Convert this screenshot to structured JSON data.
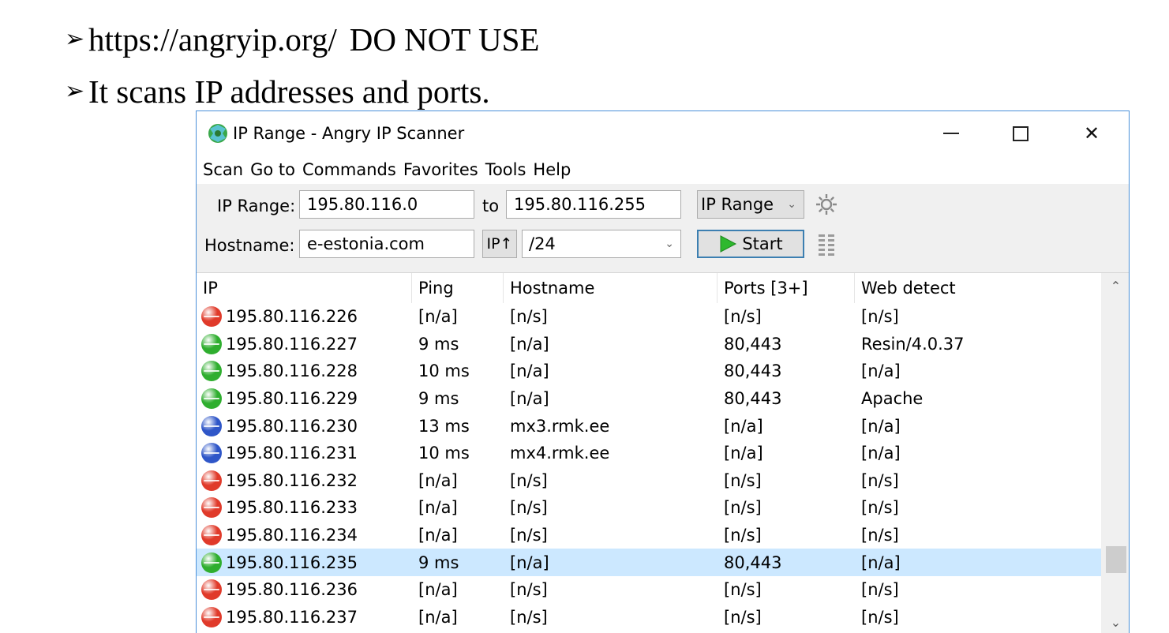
{
  "slide": {
    "bullets": [
      {
        "text": "https://angryip.org/",
        "suffix": "DO NOT USE"
      },
      {
        "text": "It scans IP addresses and ports.",
        "suffix": ""
      }
    ],
    "bullet_glyph": "➢"
  },
  "window": {
    "title": "IP Range - Angry IP Scanner",
    "icon": "angry-ip-scanner-logo",
    "controls": {
      "minimize": "minimize-icon",
      "maximize": "maximize-icon",
      "close": "✕"
    }
  },
  "menu": [
    "Scan",
    "Go to",
    "Commands",
    "Favorites",
    "Tools",
    "Help"
  ],
  "toolbar": {
    "ip_range_label": "IP Range:",
    "ip_start": "195.80.116.0",
    "to_label": "to",
    "ip_end": "195.80.116.255",
    "feeder_select": "IP Range",
    "hostname_label": "Hostname:",
    "hostname_value": "e-estonia.com",
    "ip_button": "IP↑",
    "netmask_select": "/24",
    "start_button": "Start",
    "colors": {
      "start_play": "#2eb82e",
      "start_border": "#3c7fb1"
    }
  },
  "table": {
    "columns": [
      "IP",
      "Ping",
      "Hostname",
      "Ports [3+]",
      "Web detect"
    ],
    "status_colors": {
      "dead": "#e03a2a",
      "alive_open": "#2fae2f",
      "alive": "#2f56c8"
    },
    "rows": [
      {
        "status": "dead",
        "ip": "195.80.116.226",
        "ping": "[n/a]",
        "hostname": "[n/s]",
        "ports": "[n/s]",
        "web": "[n/s]"
      },
      {
        "status": "alive_open",
        "ip": "195.80.116.227",
        "ping": "9 ms",
        "hostname": "[n/a]",
        "ports": "80,443",
        "web": "Resin/4.0.37"
      },
      {
        "status": "alive_open",
        "ip": "195.80.116.228",
        "ping": "10 ms",
        "hostname": "[n/a]",
        "ports": "80,443",
        "web": "[n/a]"
      },
      {
        "status": "alive_open",
        "ip": "195.80.116.229",
        "ping": "9 ms",
        "hostname": "[n/a]",
        "ports": "80,443",
        "web": "Apache"
      },
      {
        "status": "alive",
        "ip": "195.80.116.230",
        "ping": "13 ms",
        "hostname": "mx3.rmk.ee",
        "ports": "[n/a]",
        "web": "[n/a]"
      },
      {
        "status": "alive",
        "ip": "195.80.116.231",
        "ping": "10 ms",
        "hostname": "mx4.rmk.ee",
        "ports": "[n/a]",
        "web": "[n/a]"
      },
      {
        "status": "dead",
        "ip": "195.80.116.232",
        "ping": "[n/a]",
        "hostname": "[n/s]",
        "ports": "[n/s]",
        "web": "[n/s]"
      },
      {
        "status": "dead",
        "ip": "195.80.116.233",
        "ping": "[n/a]",
        "hostname": "[n/s]",
        "ports": "[n/s]",
        "web": "[n/s]"
      },
      {
        "status": "dead",
        "ip": "195.80.116.234",
        "ping": "[n/a]",
        "hostname": "[n/s]",
        "ports": "[n/s]",
        "web": "[n/s]"
      },
      {
        "status": "alive_open",
        "ip": "195.80.116.235",
        "ping": "9 ms",
        "hostname": "[n/a]",
        "ports": "80,443",
        "web": "[n/a]",
        "selected": true
      },
      {
        "status": "dead",
        "ip": "195.80.116.236",
        "ping": "[n/a]",
        "hostname": "[n/s]",
        "ports": "[n/s]",
        "web": "[n/s]"
      },
      {
        "status": "dead",
        "ip": "195.80.116.237",
        "ping": "[n/a]",
        "hostname": "[n/s]",
        "ports": "[n/s]",
        "web": "[n/s]"
      }
    ]
  },
  "scrollbar": {
    "up": "⌃",
    "down": "⌄"
  }
}
